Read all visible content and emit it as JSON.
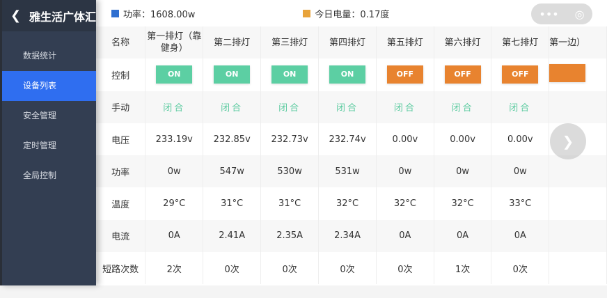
{
  "sidebar": {
    "title": "雅生活广体汇",
    "items": [
      {
        "label": "数据统计"
      },
      {
        "label": "设备列表",
        "active": true
      },
      {
        "label": "安全管理"
      },
      {
        "label": "定时管理"
      },
      {
        "label": "全局控制"
      }
    ]
  },
  "summary": {
    "power_label": "功率：1608.00w",
    "power_color": "#2f6fd0",
    "energy_label": "今日电量：0.17度",
    "energy_color": "#e8a33a"
  },
  "table": {
    "row_labels": [
      "名称",
      "控制",
      "手动",
      "电压",
      "功率",
      "温度",
      "电流",
      "短路次数"
    ],
    "columns": [
      {
        "name": "第一排灯（靠健身）",
        "control": "ON",
        "manual": "闭合",
        "voltage": "233.19v",
        "power": "0w",
        "temp": "29°C",
        "current": "0A",
        "shorts": "2次"
      },
      {
        "name": "第二排灯",
        "control": "ON",
        "manual": "闭合",
        "voltage": "232.85v",
        "power": "547w",
        "temp": "31°C",
        "current": "2.41A",
        "shorts": "0次"
      },
      {
        "name": "第三排灯",
        "control": "ON",
        "manual": "闭合",
        "voltage": "232.73v",
        "power": "530w",
        "temp": "31°C",
        "current": "2.35A",
        "shorts": "0次"
      },
      {
        "name": "第四排灯",
        "control": "ON",
        "manual": "闭合",
        "voltage": "232.74v",
        "power": "531w",
        "temp": "32°C",
        "current": "2.34A",
        "shorts": "0次"
      },
      {
        "name": "第五排灯",
        "control": "OFF",
        "manual": "闭合",
        "voltage": "0.00v",
        "power": "0w",
        "temp": "32°C",
        "current": "0A",
        "shorts": "0次"
      },
      {
        "name": "第六排灯",
        "control": "OFF",
        "manual": "闭合",
        "voltage": "0.00v",
        "power": "0w",
        "temp": "32°C",
        "current": "0A",
        "shorts": "1次"
      },
      {
        "name": "第七排灯",
        "control": "OFF",
        "manual": "闭合",
        "voltage": "0.00v",
        "power": "0w",
        "temp": "33°C",
        "current": "0A",
        "shorts": "0次"
      },
      {
        "name": "第一边）",
        "control": "",
        "manual": "",
        "voltage": "",
        "power": "",
        "temp": "",
        "current": "",
        "shorts": ""
      }
    ],
    "on_color": "#5ccfa3",
    "off_color": "#e8832f"
  }
}
